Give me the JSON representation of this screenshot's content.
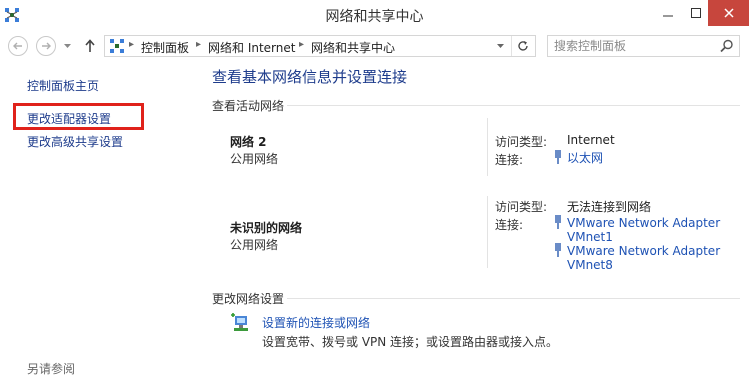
{
  "window": {
    "title": "网络和共享中心"
  },
  "address_bar": {
    "crumbs": [
      "控制面板",
      "网络和 Internet",
      "网络和共享中心"
    ]
  },
  "search": {
    "placeholder": "搜索控制面板"
  },
  "sidebar": {
    "items": [
      {
        "label": "控制面板主页"
      },
      {
        "label": "更改适配器设置"
      },
      {
        "label": "更改高级共享设置"
      }
    ],
    "see_also": "另请参阅"
  },
  "main": {
    "heading": "查看基本网络信息并设置连接",
    "active_networks_title": "查看活动网络",
    "networks": [
      {
        "name": "网络 2",
        "type": "公用网络",
        "access_label": "访问类型:",
        "access_value": "Internet",
        "conn_label": "连接:",
        "connections": [
          "以太网"
        ]
      },
      {
        "name": "未识别的网络",
        "type": "公用网络",
        "access_label": "访问类型:",
        "access_value": "无法连接到网络",
        "conn_label": "连接:",
        "connections": [
          "VMware Network Adapter VMnet1",
          "VMware Network Adapter VMnet8"
        ],
        "connection_lines": [
          [
            "VMware Network Adapter",
            "VMnet1"
          ],
          [
            "VMware Network Adapter",
            "VMnet8"
          ]
        ]
      }
    ],
    "change_settings_title": "更改网络设置",
    "setup": {
      "link": "设置新的连接或网络",
      "desc": "设置宽带、拨号或 VPN 连接；或设置路由器或接入点。"
    }
  },
  "icons": {
    "app": "network-icon",
    "address": "control-panel-icon",
    "search": "search-icon",
    "refresh": "refresh-icon",
    "up": "up-arrow-icon",
    "connection": "ethernet-plug-icon",
    "setup": "new-connection-icon"
  },
  "colors": {
    "link": "#1e52b4",
    "heading": "#1e3c8c",
    "highlight": "#e0221b",
    "close_button": "#c7463d"
  }
}
